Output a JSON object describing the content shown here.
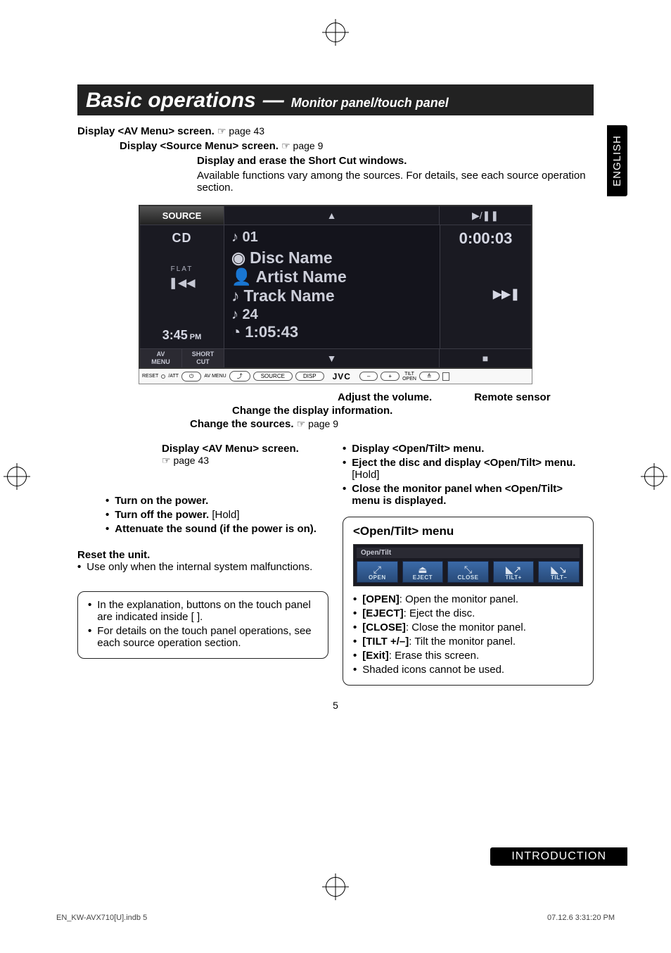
{
  "language_tab": "ENGLISH",
  "title": {
    "main": "Basic operations",
    "dash": "—",
    "sub": "Monitor panel/touch panel"
  },
  "callouts_top": {
    "av_menu": "Display <AV Menu> screen.",
    "av_menu_ref": "☞ page 43",
    "source_menu": "Display <Source Menu> screen.",
    "source_menu_ref": "☞ page 9",
    "shortcut_head": "Display and erase the Short Cut windows.",
    "shortcut_body": "Available functions vary among the sources. For details, see each source operation section."
  },
  "screen": {
    "source_btn": "SOURCE",
    "up": "▲",
    "play_pause": "▶/❚❚",
    "cd": "CD",
    "flat": "FLAT",
    "prev": "❚◀◀",
    "clock": "3:45",
    "pm": "PM",
    "track_no": "♪ 01",
    "disc": "Disc Name",
    "artist": "Artist Name",
    "track_name": "Track Name",
    "tr24": "♪ 24",
    "duration": "1:05:43",
    "elapsed": "0:00:03",
    "next": "▶▶❚",
    "tab_av": "AV\nMENU",
    "tab_short": "SHORT\nCUT",
    "down": "▼",
    "stop": "■"
  },
  "panel_strip": {
    "reset": "RESET",
    "att": "/ATT",
    "avmenu": "AV MENU",
    "source": "SOURCE",
    "disp": "DISP",
    "jvc": "JVC",
    "minus": "–",
    "plus": "+",
    "tilt": "TILT",
    "open": "OPEN"
  },
  "mid_callouts": {
    "volume": "Adjust the volume.",
    "remote": "Remote sensor",
    "display_info": "Change the display information.",
    "change_sources": "Change the sources.",
    "change_sources_ref": "☞ page 9"
  },
  "left_block": {
    "av_menu": "Display <AV Menu> screen.",
    "av_menu_ref": "☞ page 43",
    "power_on": "Turn on the power.",
    "power_off": "Turn off the power.",
    "power_off_hold": " [Hold]",
    "attenuate": "Attenuate the sound (if the power is on).",
    "reset_head": "Reset the unit.",
    "reset_body": "Use only when the internal system malfunctions.",
    "note_1": "In the explanation, buttons on the touch panel are indicated inside [       ].",
    "note_2": "For details on the touch panel operations, see each source operation section."
  },
  "right_block": {
    "open_tilt_menu": "Display <Open/Tilt> menu.",
    "eject_hold": "Eject the disc and display <Open/Tilt> menu.",
    "eject_hold_suffix": " [Hold]",
    "close": "Close the monitor panel when <Open/Tilt> menu is displayed.",
    "box_title": "<Open/Tilt> menu",
    "box_header": "Open/Tilt",
    "icons": {
      "open": "OPEN",
      "eject": "EJECT",
      "close": "CLOSE",
      "tilt_plus": "TILT+",
      "tilt_minus": "TILT–"
    },
    "desc_open_b": "[OPEN]",
    "desc_open": ": Open the monitor panel.",
    "desc_eject_b": "[EJECT]",
    "desc_eject": ": Eject the disc.",
    "desc_close_b": "[CLOSE]",
    "desc_close": ": Close the monitor panel.",
    "desc_tilt_b": "[TILT +/–]",
    "desc_tilt": ": Tilt the monitor panel.",
    "desc_exit_b": "[Exit]",
    "desc_exit": ": Erase this screen.",
    "desc_shaded": "Shaded icons cannot be used."
  },
  "page_number": "5",
  "section_tab": "INTRODUCTION",
  "footer": {
    "left": "EN_KW-AVX710[U].indb   5",
    "right": "07.12.6   3:31:20 PM"
  }
}
